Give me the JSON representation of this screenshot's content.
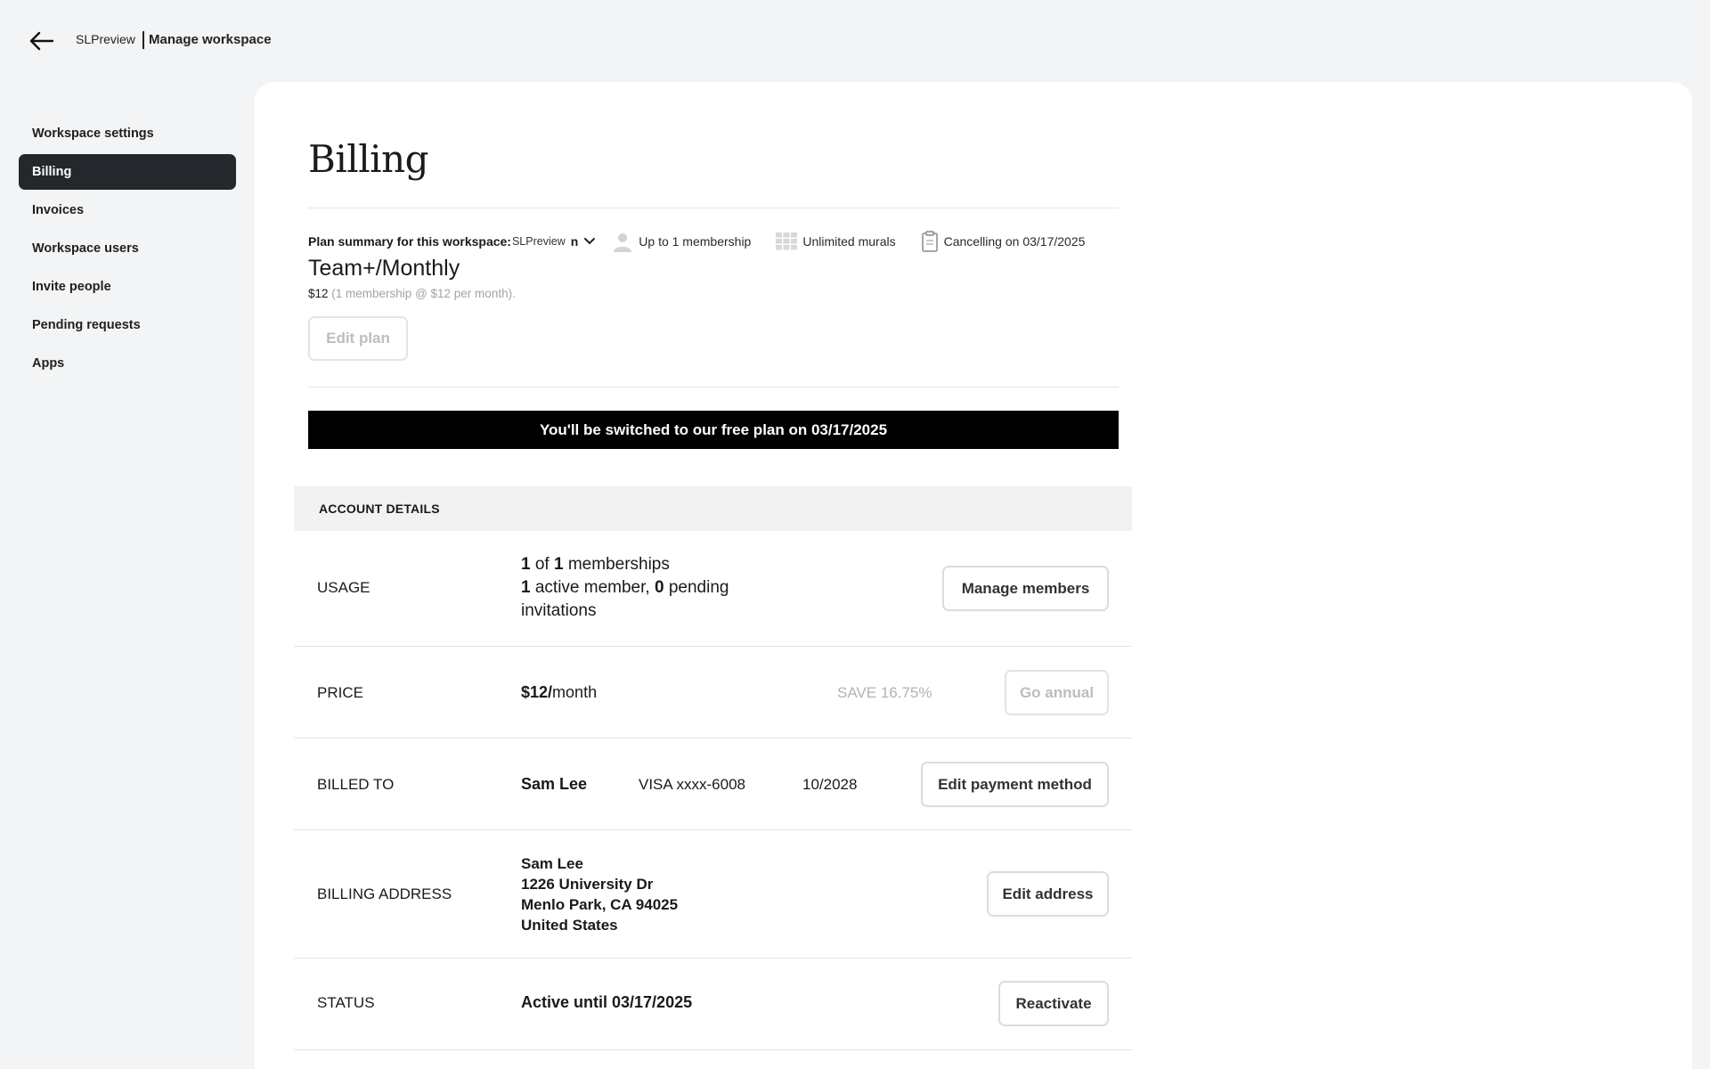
{
  "header": {
    "workspace_name": "SLPreview",
    "page_title": "Manage workspace"
  },
  "sidebar": {
    "items": [
      {
        "label": "Workspace settings"
      },
      {
        "label": "Billing",
        "active": true
      },
      {
        "label": "Invoices"
      },
      {
        "label": "Workspace users"
      },
      {
        "label": "Invite people"
      },
      {
        "label": "Pending requests"
      },
      {
        "label": "Apps"
      }
    ]
  },
  "billing": {
    "title": "Billing",
    "plan_summary_label": "Plan summary for this workspace:",
    "plan_summary_workspace": "SLPreview",
    "plan_summary_extra": "n",
    "features": {
      "membership": "Up to 1 membership",
      "murals": "Unlimited murals",
      "cancelling": "Cancelling on 03/17/2025"
    },
    "plan_name": "Team+/Monthly",
    "plan_price": "$12",
    "plan_price_detail": " (1 membership @ $12 per month).",
    "edit_plan_label": "Edit plan",
    "banner": "You'll be switched to our free plan on 03/17/2025"
  },
  "account_details": {
    "heading": "ACCOUNT DETAILS",
    "usage": {
      "label": "USAGE",
      "used": "1",
      "of_text": " of ",
      "total": "1",
      "memberships_text": " memberships",
      "active": "1",
      "active_text": " active member, ",
      "pending": "0",
      "pending_text": " pending invitations",
      "button": "Manage members"
    },
    "price": {
      "label": "PRICE",
      "amount": "$12/",
      "period": "month",
      "save": "SAVE 16.75%",
      "button": "Go annual"
    },
    "billed_to": {
      "label": "BILLED TO",
      "name": "Sam Lee",
      "card": "VISA xxxx-6008",
      "expiry": "10/2028",
      "button": "Edit payment method"
    },
    "billing_address": {
      "label": "BILLING ADDRESS",
      "line1": "Sam Lee",
      "line2": "1226 University Dr",
      "line3": "Menlo Park, CA 94025",
      "line4": "United States",
      "button": "Edit address"
    },
    "status": {
      "label": "STATUS",
      "value": "Active until 03/17/2025",
      "button": "Reactivate"
    }
  }
}
